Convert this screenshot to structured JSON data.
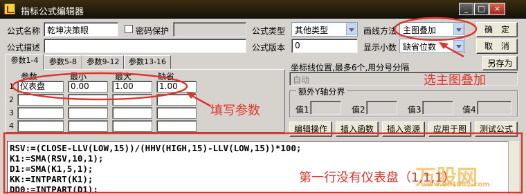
{
  "window": {
    "title": "指标公式编辑器",
    "min": "_",
    "max": "□",
    "close": "×"
  },
  "form": {
    "name_label": "公式名称",
    "name_value": "乾坤决策眼",
    "password_label": "密码保护",
    "password_value": "",
    "desc_label": "公式描述",
    "desc_value": "",
    "type_label": "公式类型",
    "type_value": "其他类型",
    "draw_label": "画线方法",
    "draw_value": "主图叠加",
    "version_label": "公式版本",
    "version_value": "0",
    "decimal_label": "显示小数",
    "decimal_value": "缺省位数"
  },
  "buttons": {
    "ok": "确　定",
    "cancel": "取　消",
    "save_as": "另存为"
  },
  "tabs": [
    "参数1-4",
    "参数5-8",
    "参数9-12",
    "参数13-16"
  ],
  "params": {
    "headers": {
      "name": "参数",
      "min": "最小",
      "max": "最大",
      "default": "缺省"
    },
    "rows": [
      {
        "num": "1",
        "name": "仪表盘",
        "min": "0.00",
        "max": "1.00",
        "default": "1.00"
      },
      {
        "num": "2",
        "name": "",
        "min": "",
        "max": "",
        "default": ""
      },
      {
        "num": "3",
        "name": "",
        "min": "",
        "max": "",
        "default": ""
      },
      {
        "num": "4",
        "name": "",
        "min": "",
        "max": "",
        "default": ""
      }
    ]
  },
  "coord": {
    "label": "坐标线位置,最多6个,用分号分隔",
    "value": "自动"
  },
  "yaxis": {
    "title": "额外Y轴分界",
    "labels": [
      "值1",
      "值2",
      "值3",
      "值4"
    ],
    "values": [
      "",
      "",
      "",
      ""
    ]
  },
  "toolbar": [
    "编辑操作",
    "插入函数",
    "插入资源",
    "应用于图",
    "测试公式"
  ],
  "code": [
    "RSV:=(CLOSE-LLV(LOW,15))/(HHV(HIGH,15)-LLV(LOW,15))*100;",
    "K1:=SMA(RSV,10,1);",
    "D1:=SMA(K1,5,1);",
    "KK:=INTPART(K1);",
    "DD0:=INTPART(D1);"
  ],
  "annotations": {
    "select_main": "选主图叠加",
    "fill_params": "填写参数",
    "first_line": "第一行没有仪表盘（1,1,1）"
  },
  "watermark": {
    "text": "万股网",
    "url": "www.201082.com"
  },
  "colors": {
    "annotation": "#e3342b",
    "titlebar": "#251d0b",
    "background": "#d6d3ce"
  }
}
